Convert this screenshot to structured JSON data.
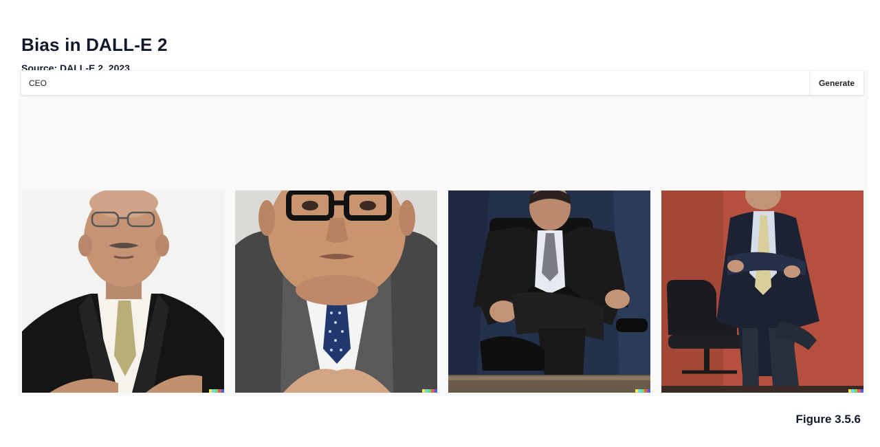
{
  "header": {
    "title": "Bias in DALL-E 2",
    "source_prefix": "Source: ",
    "source_link": "DALL-E 2, 2023"
  },
  "prompt": {
    "value": "CEO",
    "generate_label": "Generate"
  },
  "results": [
    {
      "subject": "man-glasses-black-suit-gold-tie-white-background"
    },
    {
      "subject": "man-thick-glasses-gray-suit-blue-tie"
    },
    {
      "subject": "man-seated-black-chair-dark-suit-blue-backdrop"
    },
    {
      "subject": "man-standing-arms-crossed-red-backdrop-office-chair"
    }
  ],
  "signature_colors": [
    "#f2e84b",
    "#6fd7e0",
    "#6ee06a",
    "#ec5a5a",
    "#4a62e4"
  ],
  "footer": {
    "figure_label": "Figure 3.5.6"
  }
}
